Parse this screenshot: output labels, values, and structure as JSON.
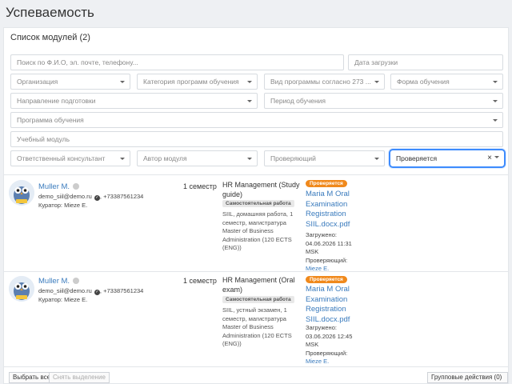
{
  "page": {
    "title": "Успеваемость"
  },
  "panel": {
    "heading": "Список модулей (2)"
  },
  "filters": {
    "search_placeholder": "Поиск по Ф.И.О, эл. почте, телефону...",
    "upload_date_placeholder": "Дата загрузки",
    "organization": "Организация",
    "program_category": "Категория программ обучения",
    "program_type": "Вид программы согласно 273 ...",
    "study_form": "Форма обучения",
    "direction": "Направление подготовки",
    "period": "Период обучения",
    "program": "Программа обучения",
    "module": "Учебный модуль",
    "consultant": "Ответственный консультант",
    "module_author": "Автор модуля",
    "reviewer": "Проверяющий",
    "status_value": "Проверяется",
    "status_clear": "×"
  },
  "rows": [
    {
      "name": "Muller M.",
      "email": "demo_siil@demo.ru",
      "phone": ", +73387561234",
      "curator": "Куратор: Mieze E.",
      "semester": "1 семестр",
      "assignment": "HR Management (Study guide)",
      "type": "Самостоятельная работа",
      "description": "SIIL, домашняя работа, 1 семестр, магистратура Master of Business Administration (120 ECTS (ENG))",
      "status": "Проверяется",
      "file": "Maria M Oral Examination Registration SIIL.docx.pdf",
      "uploaded_label": "Загружено:",
      "uploaded_value": "04.06.2026 11:31 MSK",
      "reviewer_label": "Проверяющий:",
      "reviewer_value": "Mieze E."
    },
    {
      "name": "Muller M.",
      "email": "demo_siil@demo.ru",
      "phone": ", +73387561234",
      "curator": "Куратор: Mieze E.",
      "semester": "1 семестр",
      "assignment": "HR Management (Oral exam)",
      "type": "Самостоятельная работа",
      "description": "SIIL, устный экзамен, 1 семестр, магистратура Master of Business Administration (120 ECTS (ENG))",
      "status": "Проверяется",
      "file": "Maria M Oral Examination Registration SIIL.docx.pdf",
      "uploaded_label": "Загружено:",
      "uploaded_value": "03.06.2026 12:45 MSK",
      "reviewer_label": "Проверяющий:",
      "reviewer_value": "Mieze E."
    }
  ],
  "footer": {
    "select_all": "Выбрать все",
    "deselect": "Снять выделение",
    "group_actions": "Групповые действия (0)"
  },
  "colors": {
    "accent": "#3d8bfd",
    "link": "#3a7bbd",
    "status_orange": "#f0891c"
  },
  "icons": {
    "avatar": "owl-mascot-icon",
    "online": "status-dot-icon",
    "verified": "verified-check-icon"
  }
}
